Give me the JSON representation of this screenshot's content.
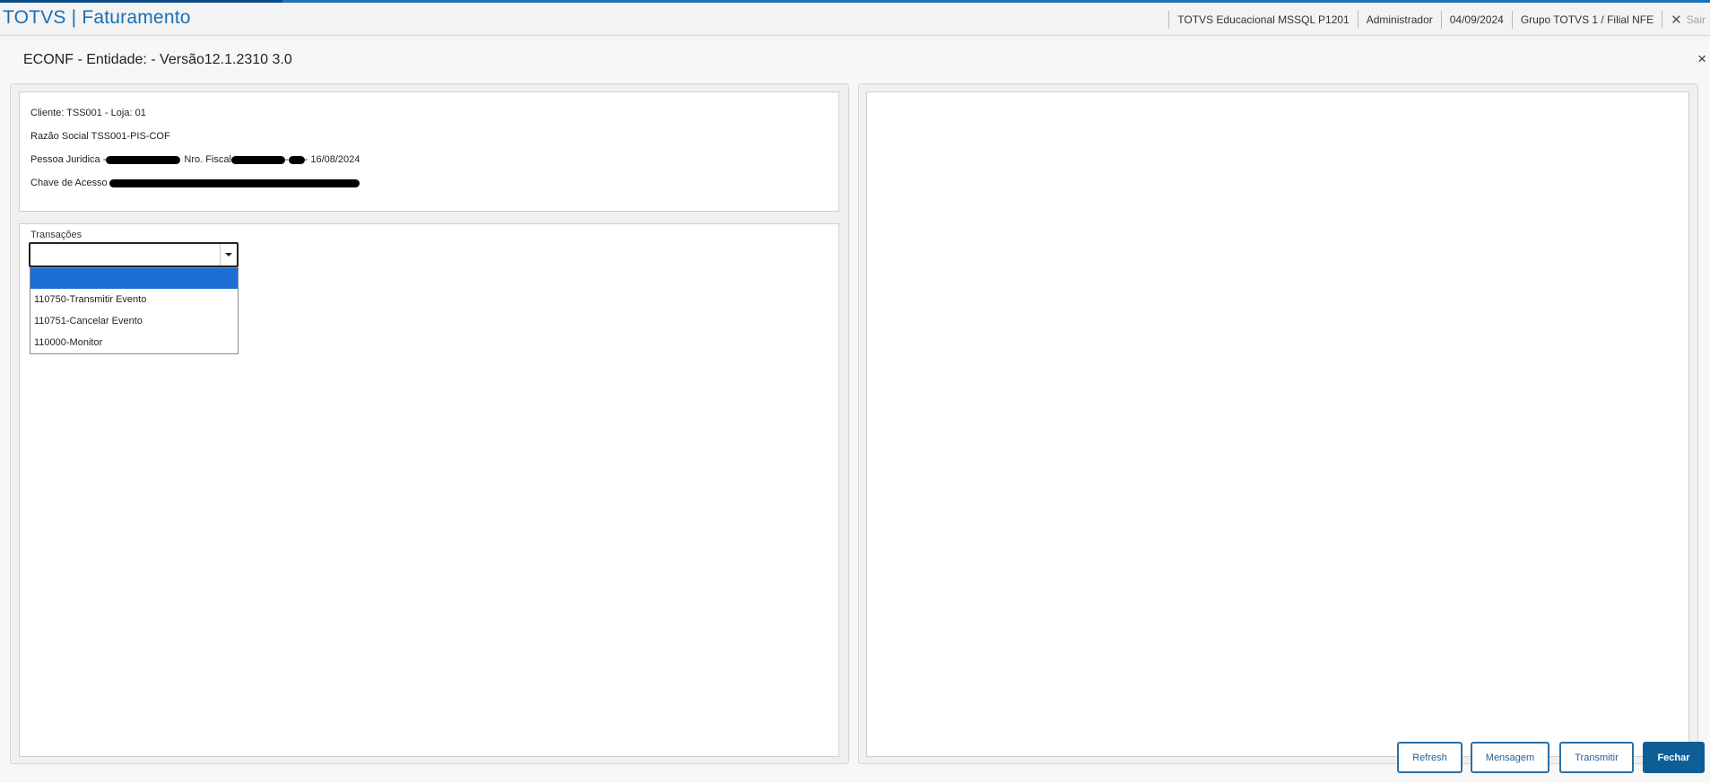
{
  "app": {
    "title": "TOTVS | Faturamento",
    "environment": "TOTVS Educacional MSSQL P1201",
    "user": "Administrador",
    "date": "04/09/2024",
    "branch": "Grupo TOTVS 1 / Filial NFE",
    "logout_label": "Sair"
  },
  "dialog": {
    "title": "ECONF - Entidade: - Versão12.1.2310  3.0",
    "close_symbol": "×"
  },
  "info": {
    "client": "Cliente: TSS001 - Loja: 01",
    "company": "Razão Social TSS001-PIS-COF",
    "person_prefix": "Pessoa Juridica - ",
    "fiscal_label": "Nro. Fiscal",
    "fiscal_sep": " -",
    "fiscal_date": "- 16/08/2024",
    "access_key_label": "Chave de Acesso"
  },
  "transactions": {
    "label": "Transações",
    "selected_value": "",
    "options": [
      "",
      "110750-Transmitir Evento",
      "110751-Cancelar Evento",
      "110000-Monitor"
    ]
  },
  "buttons": {
    "refresh": "Refresh",
    "message": "Mensagem",
    "transmit": "Transmitir",
    "close": "Fechar"
  },
  "colors": {
    "brand_blue": "#1a6fb3",
    "selection_blue": "#1d6fd6",
    "primary_button": "#0d5f96"
  },
  "icons": {
    "close": "close-icon",
    "logout": "close-icon",
    "combo_arrow": "chevron-down-icon"
  }
}
